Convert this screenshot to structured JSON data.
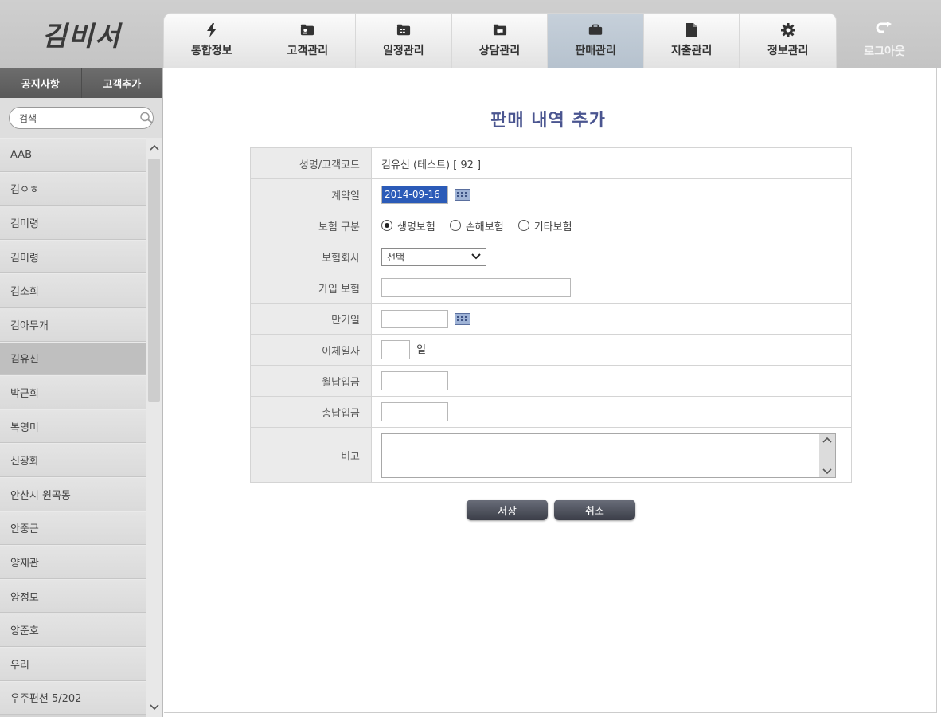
{
  "app": {
    "logo_text": "김비서"
  },
  "nav": {
    "tabs": [
      {
        "label": "통합정보",
        "icon": "lightning-icon"
      },
      {
        "label": "고객관리",
        "icon": "customer-card-icon"
      },
      {
        "label": "일정관리",
        "icon": "calendar-folder-icon"
      },
      {
        "label": "상담관리",
        "icon": "consult-folder-icon"
      },
      {
        "label": "판매관리",
        "icon": "briefcase-icon",
        "active": true
      },
      {
        "label": "지출관리",
        "icon": "document-icon"
      },
      {
        "label": "정보관리",
        "icon": "gear-icon"
      }
    ],
    "logout": {
      "label": "로그아웃",
      "icon": "logout-arrow-icon"
    }
  },
  "sidebar": {
    "notice_label": "공지사항",
    "add_customer_label": "고객추가",
    "search": {
      "placeholder": "검색",
      "value": "검색"
    },
    "customers": [
      "AAB",
      "김ㅇㅎ",
      "김미령",
      "김미령",
      "김소희",
      "김아무개",
      "김유신",
      "박근희",
      "복영미",
      "신광화",
      "안산시 원곡동",
      "안중근",
      "양재관",
      "양정모",
      "양준호",
      "우리",
      "우주편션 5/202"
    ],
    "selected_customer": "김유신"
  },
  "form": {
    "title": "판매 내역 추가",
    "labels": {
      "name_code": "성명/고객코드",
      "contract_date": "계약일",
      "insurance_type": "보험 구분",
      "insurance_company": "보험회사",
      "product": "가입 보험",
      "maturity_date": "만기일",
      "transfer_day": "이체일자",
      "monthly_payment": "월납입금",
      "total_payment": "총납입금",
      "memo": "비고"
    },
    "values": {
      "name_code": "김유신 (테스트)  [ 92 ]",
      "contract_date": "2014-09-16",
      "insurance_options": [
        "생명보험",
        "손해보험",
        "기타보험"
      ],
      "insurance_selected": "생명보험",
      "insurance_company": "선택",
      "product": "",
      "maturity_date": "",
      "transfer_day": "",
      "transfer_day_unit": "일",
      "monthly_payment": "",
      "total_payment": "",
      "memo": ""
    },
    "buttons": {
      "save": "저장",
      "cancel": "취소"
    }
  },
  "colors": {
    "title": "#4a5590",
    "active_tab": "#b6c2ce",
    "button": "#4b4f5b",
    "selection": "#2b5bb8"
  }
}
